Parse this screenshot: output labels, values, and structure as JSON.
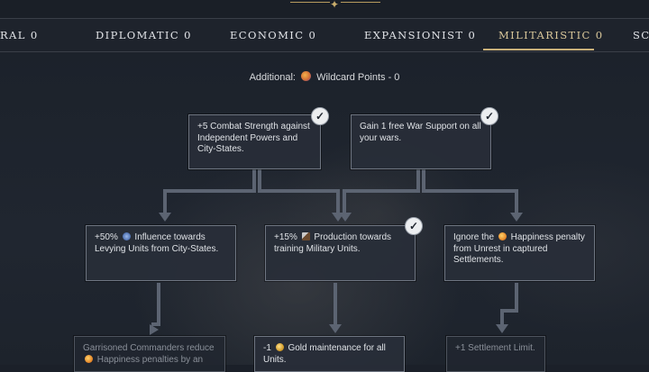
{
  "tabs": [
    {
      "label": "RAL 0",
      "active": false
    },
    {
      "label": "DIPLOMATIC 0",
      "active": false
    },
    {
      "label": "ECONOMIC 0",
      "active": false
    },
    {
      "label": "EXPANSIONIST 0",
      "active": false
    },
    {
      "label": "MILITARISTIC 0",
      "active": true
    },
    {
      "label": "SC",
      "active": false
    }
  ],
  "additional": {
    "label": "Additional:",
    "icon": "wildcard-icon",
    "value": "Wildcard Points - 0"
  },
  "nodes": {
    "combat": {
      "text": "+5 Combat Strength against Independent Powers and City-States.",
      "completed": true
    },
    "war_support": {
      "text": "Gain 1 free War Support on all your wars.",
      "completed": true
    },
    "influence": {
      "prefix": "+50%",
      "icon": "influence-icon",
      "text": "Influence towards Levying Units from City-States.",
      "completed": false
    },
    "production": {
      "prefix": "+15%",
      "icon": "production-icon",
      "text": "Production towards training Military Units.",
      "completed": true
    },
    "happiness": {
      "prefix": "Ignore the",
      "icon": "happiness-icon",
      "text": "Happiness penalty from Unrest in captured Settlements.",
      "completed": false
    },
    "commanders": {
      "prefix": "Garrisoned Commanders reduce",
      "icon": "happiness-icon",
      "text": "Happiness penalties by an",
      "completed": false
    },
    "gold": {
      "prefix": "-1",
      "icon": "gold-icon",
      "text": "Gold maintenance for all Units.",
      "completed": false
    },
    "settlement": {
      "text": "+1 Settlement Limit.",
      "completed": false
    }
  },
  "colors": {
    "accent": "#c9b079",
    "connector": "#5c6472",
    "check_bg": "#eceef0"
  }
}
